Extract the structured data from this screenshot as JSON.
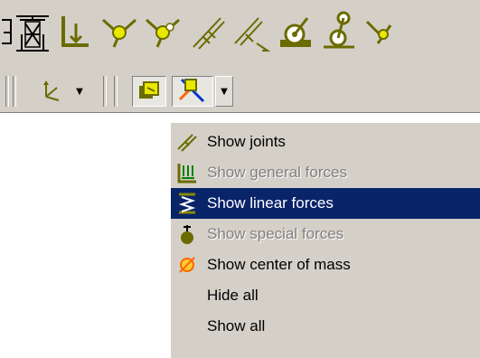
{
  "toolbar_top": {
    "icons": [
      {
        "name": "bracket-joint-icon"
      },
      {
        "name": "spring-joint-icon"
      },
      {
        "name": "fixed-support-icon"
      },
      {
        "name": "revolute-joint-icon"
      },
      {
        "name": "revolute-joint-2-icon"
      },
      {
        "name": "slider-joint-icon"
      },
      {
        "name": "slider-joint-2-icon"
      },
      {
        "name": "contact-icon"
      },
      {
        "name": "cam-contact-icon"
      },
      {
        "name": "partial-icon"
      }
    ]
  },
  "toolbar_bottom": {
    "axes_icon": "axes-icon",
    "display_icon": "display-parts-icon",
    "visibility_icon": "visibility-filter-icon"
  },
  "menu": {
    "items": [
      {
        "label": "Show joints",
        "icon": "joints-icon",
        "state": "normal"
      },
      {
        "label": "Show general forces",
        "icon": "general-forces-icon",
        "state": "disabled"
      },
      {
        "label": "Show linear forces",
        "icon": "linear-forces-icon",
        "state": "selected"
      },
      {
        "label": "Show special forces",
        "icon": "special-forces-icon",
        "state": "disabled"
      },
      {
        "label": "Show center of mass",
        "icon": "center-of-mass-icon",
        "state": "normal"
      },
      {
        "label": "Hide all",
        "icon": "",
        "state": "normal"
      },
      {
        "label": "Show all",
        "icon": "",
        "state": "normal"
      }
    ]
  },
  "colors": {
    "face": "#d4d0c8",
    "highlight": "#0a246a",
    "icon_olive": "#6b6b00",
    "icon_yellow": "#e8e800"
  }
}
